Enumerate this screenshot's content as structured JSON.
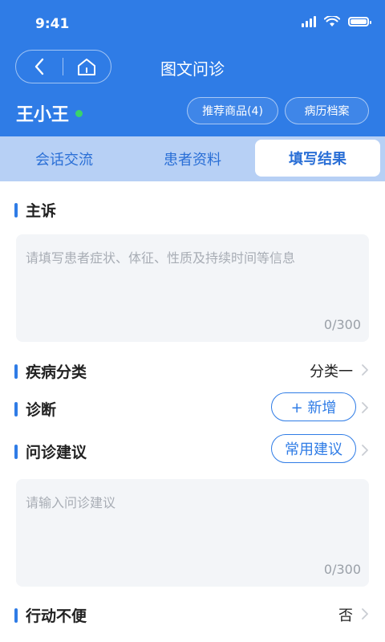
{
  "status": {
    "time": "9:41"
  },
  "header": {
    "title": "图文问诊",
    "patient_name": "王小王",
    "recommend_label": "推荐商品(4)",
    "records_label": "病历档案"
  },
  "tabs": [
    {
      "label": "会话交流"
    },
    {
      "label": "患者资料"
    },
    {
      "label": "填写结果"
    }
  ],
  "complaint": {
    "title": "主诉",
    "placeholder": "请填写患者症状、体征、性质及持续时间等信息",
    "counter": "0/300"
  },
  "disease": {
    "title": "疾病分类",
    "value": "分类一"
  },
  "diagnosis": {
    "title": "诊断",
    "add_label": "+ 新增"
  },
  "advice": {
    "title": "问诊建议",
    "common_label": "常用建议",
    "placeholder": "请输入问诊建议",
    "counter": "0/300"
  },
  "mobility": {
    "title": "行动不便",
    "value": "否"
  },
  "colors": {
    "primary": "#2f7ce6",
    "tabbar": "#b7d0f5",
    "online": "#39d36b"
  }
}
